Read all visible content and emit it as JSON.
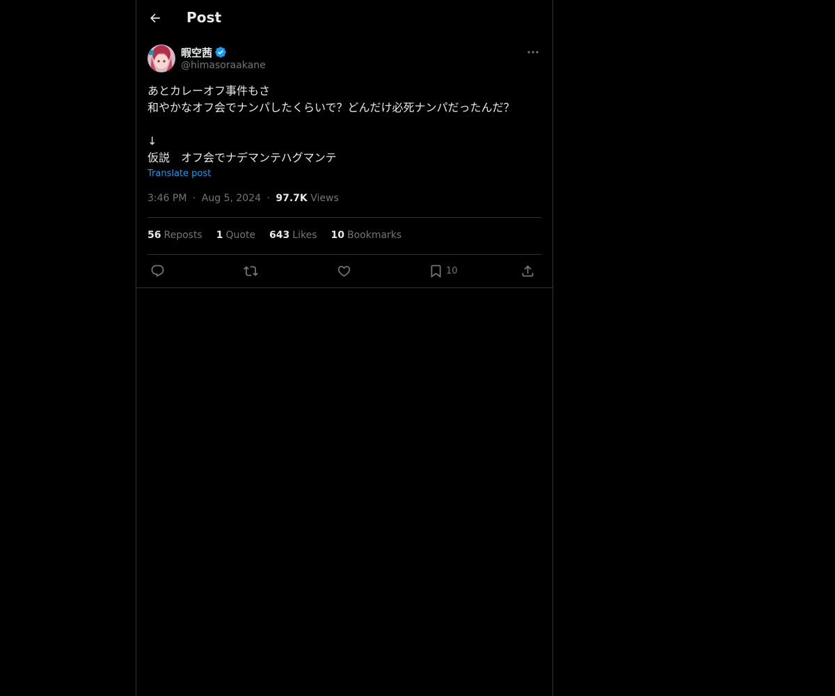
{
  "header": {
    "title": "Post",
    "back_icon": "arrow-left-icon"
  },
  "author": {
    "display_name": "暇空茜",
    "handle": "@himasoraakane",
    "verified_icon": "verified-badge-icon",
    "verified_color": "#1d9bf0"
  },
  "post": {
    "text": "あとカレーオフ事件もさ\n和やかなオフ会でナンパしたくらいで？どんだけ必死ナンパだったんだ？\n\n↓\n仮説　オフ会でナデマンテハグマンテ",
    "translate_label": "Translate post"
  },
  "meta": {
    "time": "3:46 PM",
    "date": "Aug 5, 2024",
    "views_count": "97.7K",
    "views_label": "Views",
    "separator": "·"
  },
  "stats": [
    {
      "count": "56",
      "label": "Reposts"
    },
    {
      "count": "1",
      "label": "Quote"
    },
    {
      "count": "643",
      "label": "Likes"
    },
    {
      "count": "10",
      "label": "Bookmarks"
    }
  ],
  "actions": {
    "reply_icon": "reply-icon",
    "repost_icon": "repost-icon",
    "like_icon": "heart-icon",
    "bookmark_icon": "bookmark-icon",
    "bookmark_count": "10",
    "share_icon": "share-icon"
  },
  "colors": {
    "background": "#000000",
    "text": "#e7e9ea",
    "secondary": "#71767b",
    "border": "#2f3336",
    "accent": "#1d9bf0"
  }
}
